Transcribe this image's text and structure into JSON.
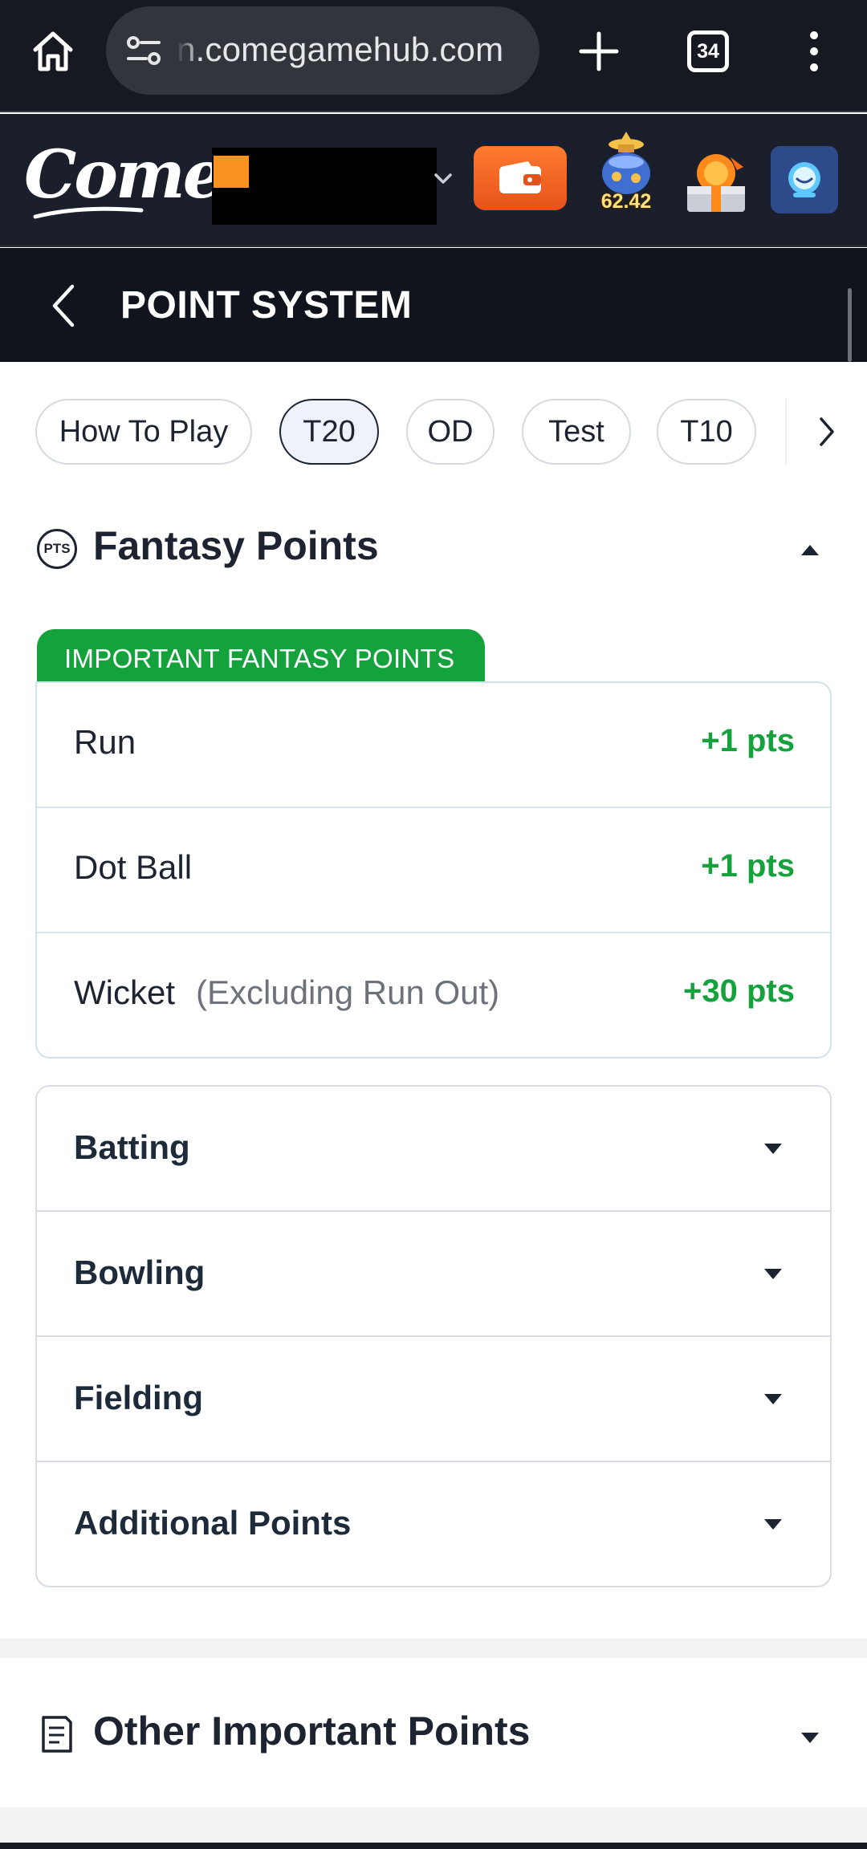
{
  "browser": {
    "url": "n.comegamehub.com",
    "tab_count": "34"
  },
  "site": {
    "logo_text": "Come",
    "jackpot_value": "62.42"
  },
  "page": {
    "title": "POINT SYSTEM"
  },
  "tabs": [
    {
      "label": "How To Play",
      "active": false
    },
    {
      "label": "T20",
      "active": true
    },
    {
      "label": "OD",
      "active": false
    },
    {
      "label": "Test",
      "active": false
    },
    {
      "label": "T10",
      "active": false
    }
  ],
  "fantasy": {
    "icon_text": "PTS",
    "title": "Fantasy Points",
    "important_tag": "IMPORTANT FANTASY POINTS",
    "important_rows": [
      {
        "label": "Run",
        "note": "",
        "value": "+1 pts"
      },
      {
        "label": "Dot Ball",
        "note": "",
        "value": "+1 pts"
      },
      {
        "label": "Wicket",
        "note": "(Excluding Run Out)",
        "value": "+30 pts"
      }
    ],
    "sections": [
      {
        "label": "Batting"
      },
      {
        "label": "Bowling"
      },
      {
        "label": "Fielding"
      },
      {
        "label": "Additional Points"
      }
    ]
  },
  "other": {
    "title": "Other Important Points"
  },
  "colors": {
    "accent_green": "#14a23d",
    "header_dark": "#10141d",
    "wallet_orange": "#ff7a2e"
  }
}
